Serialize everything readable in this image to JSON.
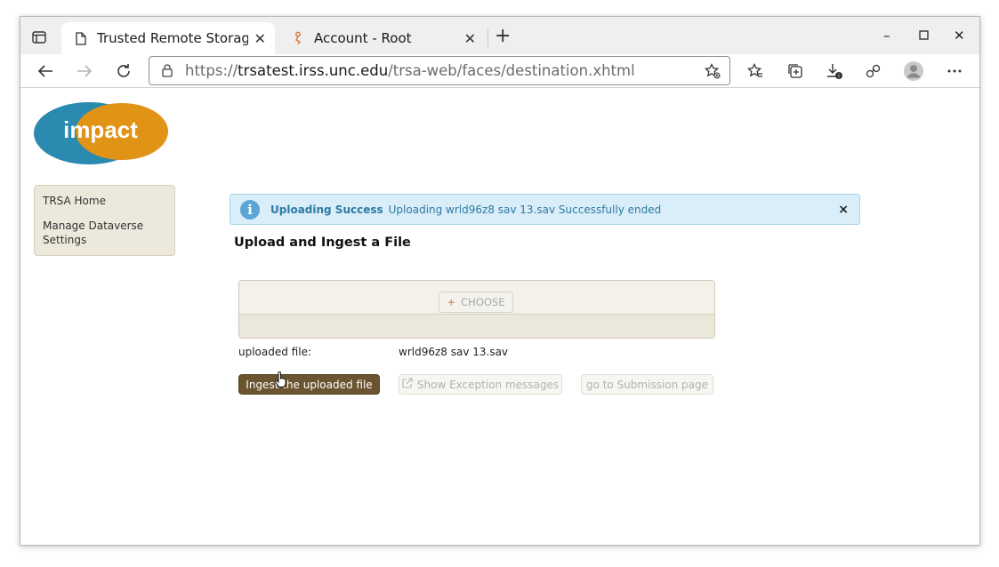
{
  "browser": {
    "tabs": [
      {
        "label": "Trusted Remote Storage A",
        "active": true
      },
      {
        "label": "Account - Root",
        "active": false
      }
    ],
    "url": {
      "host": "trsatest.irss.unc.edu",
      "path": "/trsa-web/faces/destination.xhtml",
      "scheme": "https://"
    }
  },
  "page": {
    "logo_text": "impact",
    "menu": [
      {
        "label": "TRSA Home"
      },
      {
        "label": "Manage Dataverse Settings"
      }
    ],
    "message": {
      "summary": "Uploading Success",
      "detail": "Uploading wrld96z8 sav 13.sav Successfully ended",
      "close": "×"
    },
    "title": "Upload and Ingest a File",
    "choose_label": "CHOOSE",
    "uploaded_label": "uploaded file:",
    "uploaded_value": "wrld96z8 sav 13.sav",
    "buttons": {
      "ingest": "Ingest the uploaded file",
      "exceptions": "Show Exception messages",
      "submission": "go to Submission page"
    }
  },
  "colors": {
    "logo_blue": "#2a8ab0",
    "logo_orange": "#e19315",
    "message_bg": "#d9eef8",
    "primary_button": "#6b5430"
  }
}
